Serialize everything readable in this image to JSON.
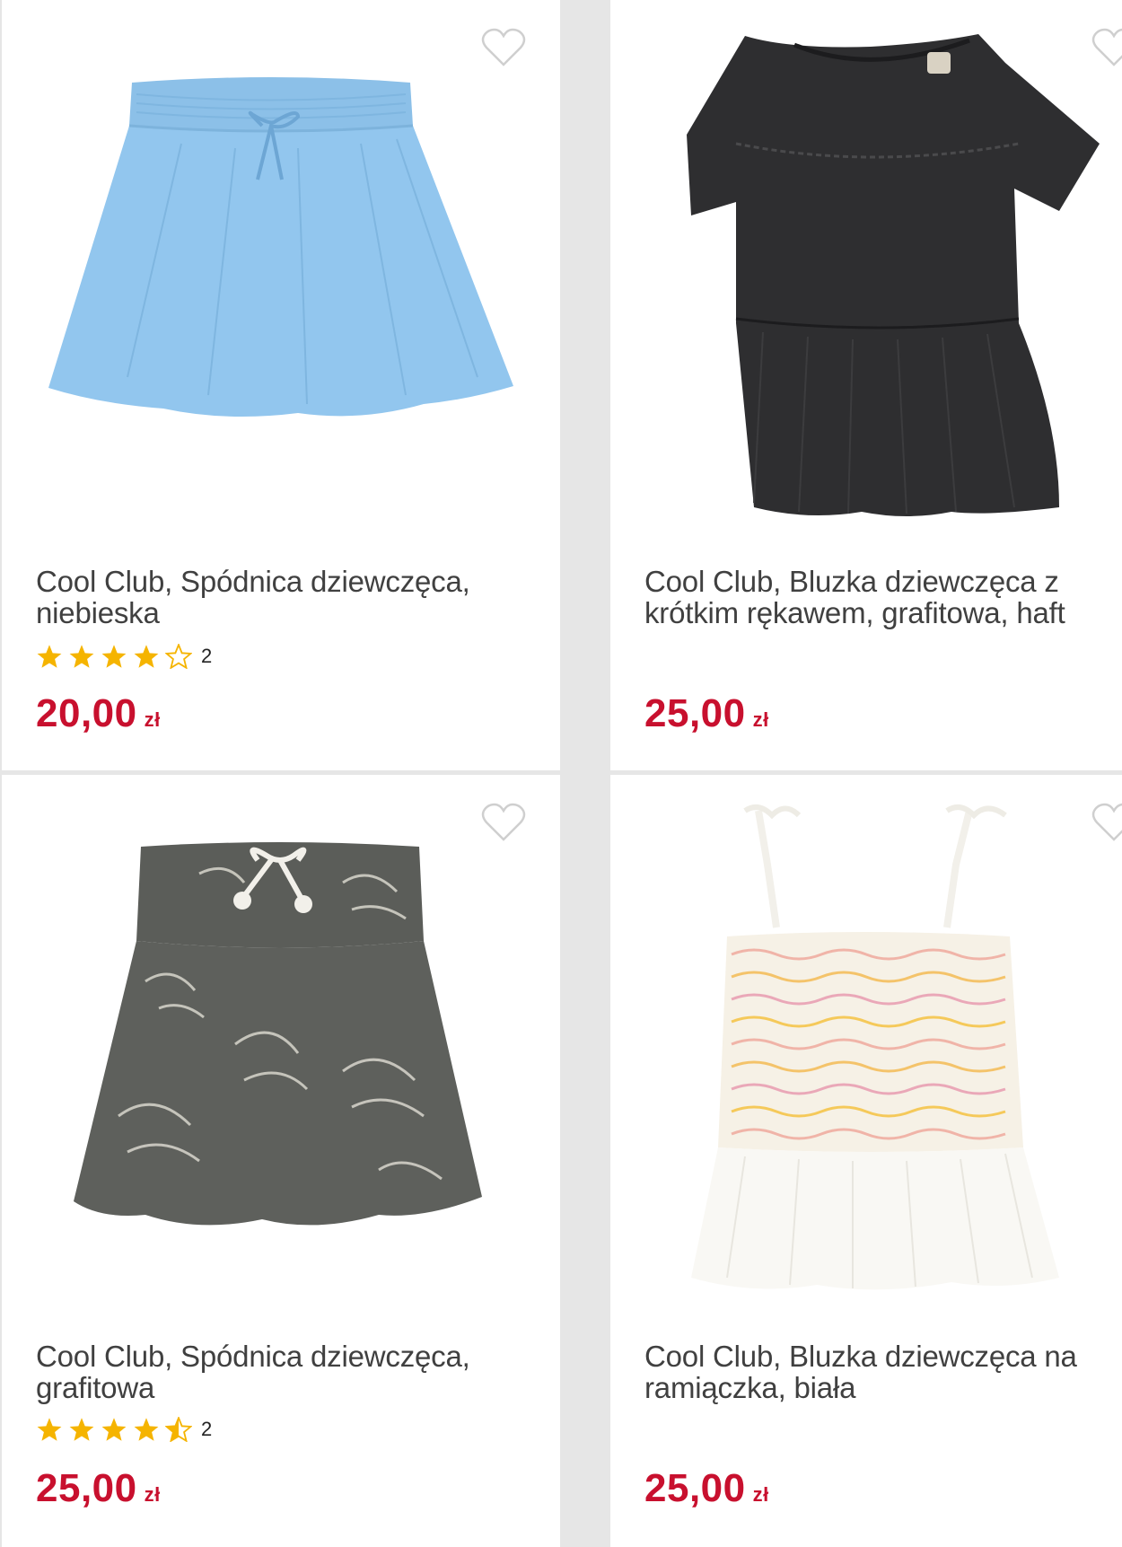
{
  "colors": {
    "price": "#c8102e",
    "star": "#f5b400",
    "background": "#e6e6e6",
    "card": "#ffffff"
  },
  "products": [
    {
      "title_line1": "Cool Club, Spódnica dziewczęca,",
      "title_line2": "niebieska",
      "rating": 4,
      "rating_count": "2",
      "price": "20,00",
      "currency": "zł",
      "image_icon": "blue-skirt-image",
      "color": "#8fc3ea"
    },
    {
      "title_line1": "Cool Club, Bluzka dziewczęca z",
      "title_line2": "krótkim rękawem, grafitowa, haft",
      "rating": null,
      "rating_count": "",
      "price": "25,00",
      "currency": "zł",
      "image_icon": "black-blouse-image",
      "color": "#2f2f31"
    },
    {
      "title_line1": "Cool Club, Spódnica dziewczęca,",
      "title_line2": "grafitowa",
      "rating": 4.5,
      "rating_count": "2",
      "price": "25,00",
      "currency": "zł",
      "image_icon": "grey-floral-skirt-image",
      "color": "#5c5e5a"
    },
    {
      "title_line1": "Cool Club, Bluzka dziewczęca na",
      "title_line2": "ramiączka, biała",
      "rating": null,
      "rating_count": "",
      "price": "25,00",
      "currency": "zł",
      "image_icon": "white-smocked-top-image",
      "color": "#f7f5f0"
    }
  ]
}
